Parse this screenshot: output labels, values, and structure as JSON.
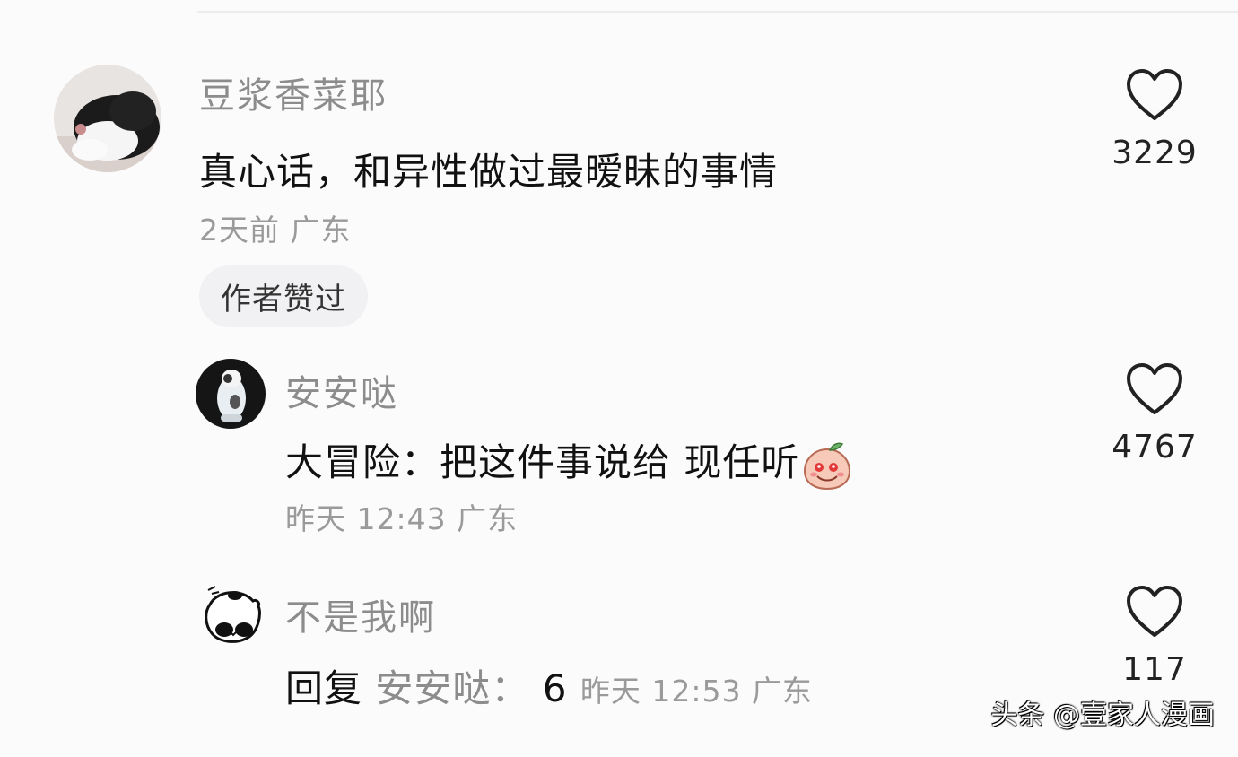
{
  "comments": [
    {
      "username": "豆浆香菜耶",
      "text": "真心话，和异性做过最暧昧的事情",
      "meta": "2天前 广东",
      "badge": "作者赞过",
      "likes": "3229",
      "avatar_icon": "cat-avatar-icon"
    },
    {
      "username": "安安哒",
      "text": "大冒险：把这件事说给 现任听",
      "emoji": "peach-emoji-icon",
      "meta": "昨天 12:43 广东",
      "likes": "4767",
      "avatar_icon": "cat-avatar-icon"
    },
    {
      "username": "不是我啊",
      "reply_prefix": "回复",
      "reply_target": "安安哒：",
      "reply_text": "6",
      "meta": "昨天 12:53 广东",
      "likes": "117",
      "avatar_icon": "panda-avatar-icon"
    }
  ],
  "watermark": "头条 @壹家人漫画",
  "colors": {
    "username": "#8c8c8c",
    "text": "#111111",
    "meta": "#9a9a9a",
    "badge_bg": "#f1f1f3"
  }
}
